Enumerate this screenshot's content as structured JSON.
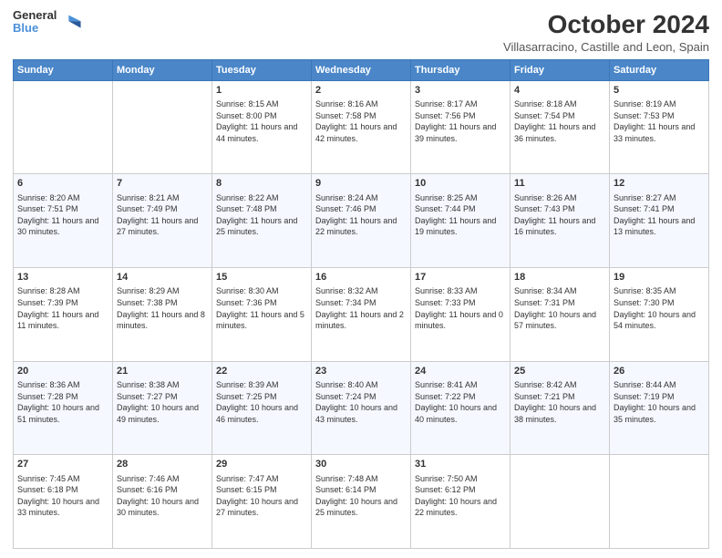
{
  "header": {
    "logo_line1": "General",
    "logo_line2": "Blue",
    "title": "October 2024",
    "subtitle": "Villasarracino, Castille and Leon, Spain"
  },
  "days_of_week": [
    "Sunday",
    "Monday",
    "Tuesday",
    "Wednesday",
    "Thursday",
    "Friday",
    "Saturday"
  ],
  "weeks": [
    [
      {
        "day": "",
        "info": ""
      },
      {
        "day": "",
        "info": ""
      },
      {
        "day": "1",
        "info": "Sunrise: 8:15 AM\nSunset: 8:00 PM\nDaylight: 11 hours and 44 minutes."
      },
      {
        "day": "2",
        "info": "Sunrise: 8:16 AM\nSunset: 7:58 PM\nDaylight: 11 hours and 42 minutes."
      },
      {
        "day": "3",
        "info": "Sunrise: 8:17 AM\nSunset: 7:56 PM\nDaylight: 11 hours and 39 minutes."
      },
      {
        "day": "4",
        "info": "Sunrise: 8:18 AM\nSunset: 7:54 PM\nDaylight: 11 hours and 36 minutes."
      },
      {
        "day": "5",
        "info": "Sunrise: 8:19 AM\nSunset: 7:53 PM\nDaylight: 11 hours and 33 minutes."
      }
    ],
    [
      {
        "day": "6",
        "info": "Sunrise: 8:20 AM\nSunset: 7:51 PM\nDaylight: 11 hours and 30 minutes."
      },
      {
        "day": "7",
        "info": "Sunrise: 8:21 AM\nSunset: 7:49 PM\nDaylight: 11 hours and 27 minutes."
      },
      {
        "day": "8",
        "info": "Sunrise: 8:22 AM\nSunset: 7:48 PM\nDaylight: 11 hours and 25 minutes."
      },
      {
        "day": "9",
        "info": "Sunrise: 8:24 AM\nSunset: 7:46 PM\nDaylight: 11 hours and 22 minutes."
      },
      {
        "day": "10",
        "info": "Sunrise: 8:25 AM\nSunset: 7:44 PM\nDaylight: 11 hours and 19 minutes."
      },
      {
        "day": "11",
        "info": "Sunrise: 8:26 AM\nSunset: 7:43 PM\nDaylight: 11 hours and 16 minutes."
      },
      {
        "day": "12",
        "info": "Sunrise: 8:27 AM\nSunset: 7:41 PM\nDaylight: 11 hours and 13 minutes."
      }
    ],
    [
      {
        "day": "13",
        "info": "Sunrise: 8:28 AM\nSunset: 7:39 PM\nDaylight: 11 hours and 11 minutes."
      },
      {
        "day": "14",
        "info": "Sunrise: 8:29 AM\nSunset: 7:38 PM\nDaylight: 11 hours and 8 minutes."
      },
      {
        "day": "15",
        "info": "Sunrise: 8:30 AM\nSunset: 7:36 PM\nDaylight: 11 hours and 5 minutes."
      },
      {
        "day": "16",
        "info": "Sunrise: 8:32 AM\nSunset: 7:34 PM\nDaylight: 11 hours and 2 minutes."
      },
      {
        "day": "17",
        "info": "Sunrise: 8:33 AM\nSunset: 7:33 PM\nDaylight: 11 hours and 0 minutes."
      },
      {
        "day": "18",
        "info": "Sunrise: 8:34 AM\nSunset: 7:31 PM\nDaylight: 10 hours and 57 minutes."
      },
      {
        "day": "19",
        "info": "Sunrise: 8:35 AM\nSunset: 7:30 PM\nDaylight: 10 hours and 54 minutes."
      }
    ],
    [
      {
        "day": "20",
        "info": "Sunrise: 8:36 AM\nSunset: 7:28 PM\nDaylight: 10 hours and 51 minutes."
      },
      {
        "day": "21",
        "info": "Sunrise: 8:38 AM\nSunset: 7:27 PM\nDaylight: 10 hours and 49 minutes."
      },
      {
        "day": "22",
        "info": "Sunrise: 8:39 AM\nSunset: 7:25 PM\nDaylight: 10 hours and 46 minutes."
      },
      {
        "day": "23",
        "info": "Sunrise: 8:40 AM\nSunset: 7:24 PM\nDaylight: 10 hours and 43 minutes."
      },
      {
        "day": "24",
        "info": "Sunrise: 8:41 AM\nSunset: 7:22 PM\nDaylight: 10 hours and 40 minutes."
      },
      {
        "day": "25",
        "info": "Sunrise: 8:42 AM\nSunset: 7:21 PM\nDaylight: 10 hours and 38 minutes."
      },
      {
        "day": "26",
        "info": "Sunrise: 8:44 AM\nSunset: 7:19 PM\nDaylight: 10 hours and 35 minutes."
      }
    ],
    [
      {
        "day": "27",
        "info": "Sunrise: 7:45 AM\nSunset: 6:18 PM\nDaylight: 10 hours and 33 minutes."
      },
      {
        "day": "28",
        "info": "Sunrise: 7:46 AM\nSunset: 6:16 PM\nDaylight: 10 hours and 30 minutes."
      },
      {
        "day": "29",
        "info": "Sunrise: 7:47 AM\nSunset: 6:15 PM\nDaylight: 10 hours and 27 minutes."
      },
      {
        "day": "30",
        "info": "Sunrise: 7:48 AM\nSunset: 6:14 PM\nDaylight: 10 hours and 25 minutes."
      },
      {
        "day": "31",
        "info": "Sunrise: 7:50 AM\nSunset: 6:12 PM\nDaylight: 10 hours and 22 minutes."
      },
      {
        "day": "",
        "info": ""
      },
      {
        "day": "",
        "info": ""
      }
    ]
  ]
}
